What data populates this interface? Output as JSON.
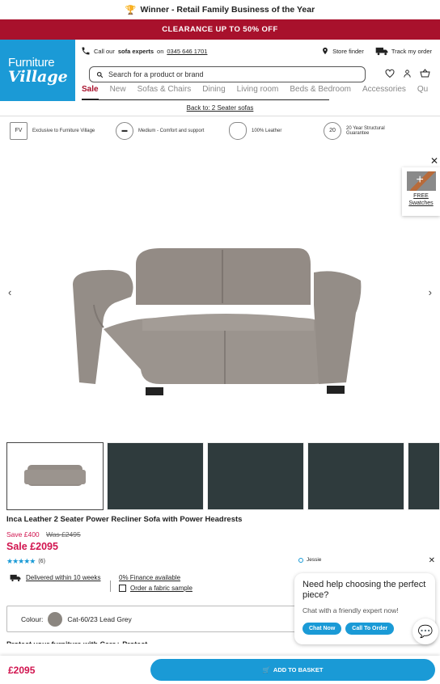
{
  "award": {
    "text": "Winner - Retail Family Business of the Year"
  },
  "promo": {
    "text": "CLEARANCE UP TO 50% OFF"
  },
  "logo": {
    "line1": "Furniture",
    "line2": "Village"
  },
  "utility": {
    "call_prefix": "Call our",
    "call_bold": "sofa experts",
    "call_on": "on",
    "phone": "0345 646 1701",
    "store_finder": "Store finder",
    "track_order": "Track my order"
  },
  "search": {
    "placeholder": "Search for a product or brand"
  },
  "nav": {
    "items": [
      "Sale",
      "New",
      "Sofas & Chairs",
      "Dining",
      "Living room",
      "Beds & Bedroom",
      "Accessories",
      "Qu"
    ]
  },
  "breadcrumb": {
    "back": "Back to: 2 Seater sofas"
  },
  "usps": [
    {
      "icon": "fv-badge-icon",
      "text": "Exclusive to Furniture Village"
    },
    {
      "icon": "sofa-icon",
      "text": "Medium - Comfort and support"
    },
    {
      "icon": "leather-hide-icon",
      "text": "100% Leather"
    },
    {
      "icon": "guarantee-20-icon",
      "text": "20 Year Structural Guarantee",
      "badge": "20"
    }
  ],
  "swatches": {
    "label": "FREE Swatches"
  },
  "product": {
    "title": "Inca Leather 2 Seater Power Recliner Sofa with Power Headrests",
    "save": "Save £400",
    "was": "Was £2495",
    "price": "Sale £2095",
    "rating_count": "(6)",
    "rating_value": 5,
    "delivery": "Delivered within 10 weeks",
    "finance": "0% Finance available",
    "fabric_sample": "Order a fabric sample",
    "colour_label": "Colour:",
    "colour_value": "Cat-60/23 Lead Grey",
    "colour_hex": "#8b8680",
    "protect": "Protect your furniture with Care+ Protect"
  },
  "chat": {
    "agent": "Jessie",
    "question": "Need help choosing the perfect piece?",
    "subtitle": "Chat with a friendly expert now!",
    "chat_now": "Chat Now",
    "call_order": "Call To Order"
  },
  "bottom": {
    "price": "£2095",
    "button": "ADD TO BASKET"
  },
  "colors": {
    "brand_blue": "#1b9ad6",
    "promo_red": "#a8112c",
    "sale_pink": "#d1144f"
  }
}
